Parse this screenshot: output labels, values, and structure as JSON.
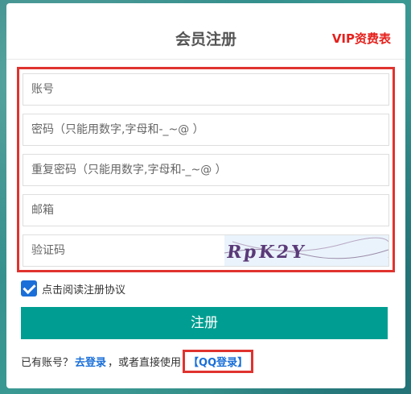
{
  "header": {
    "title": "会员注册",
    "vip_link": "VIP资费表"
  },
  "form": {
    "account_placeholder": "账号",
    "password_placeholder": "密码（只能用数字,字母和-_~@ ）",
    "repeat_password_placeholder": "重复密码（只能用数字,字母和-_~@ ）",
    "email_placeholder": "邮箱",
    "captcha_placeholder": "验证码",
    "captcha_text": "RpK2Y"
  },
  "agreement": {
    "checked": true,
    "label": "点击阅读注册协议"
  },
  "submit_label": "注册",
  "footer": {
    "prefix": "已有账号？",
    "login_link": "去登录",
    "middle": "，或者直接使用",
    "qq_login": "【QQ登录】"
  },
  "colors": {
    "accent": "#009e92",
    "highlight_border": "#e0332f",
    "link": "#1a6fd8",
    "vip": "#e5201c"
  }
}
